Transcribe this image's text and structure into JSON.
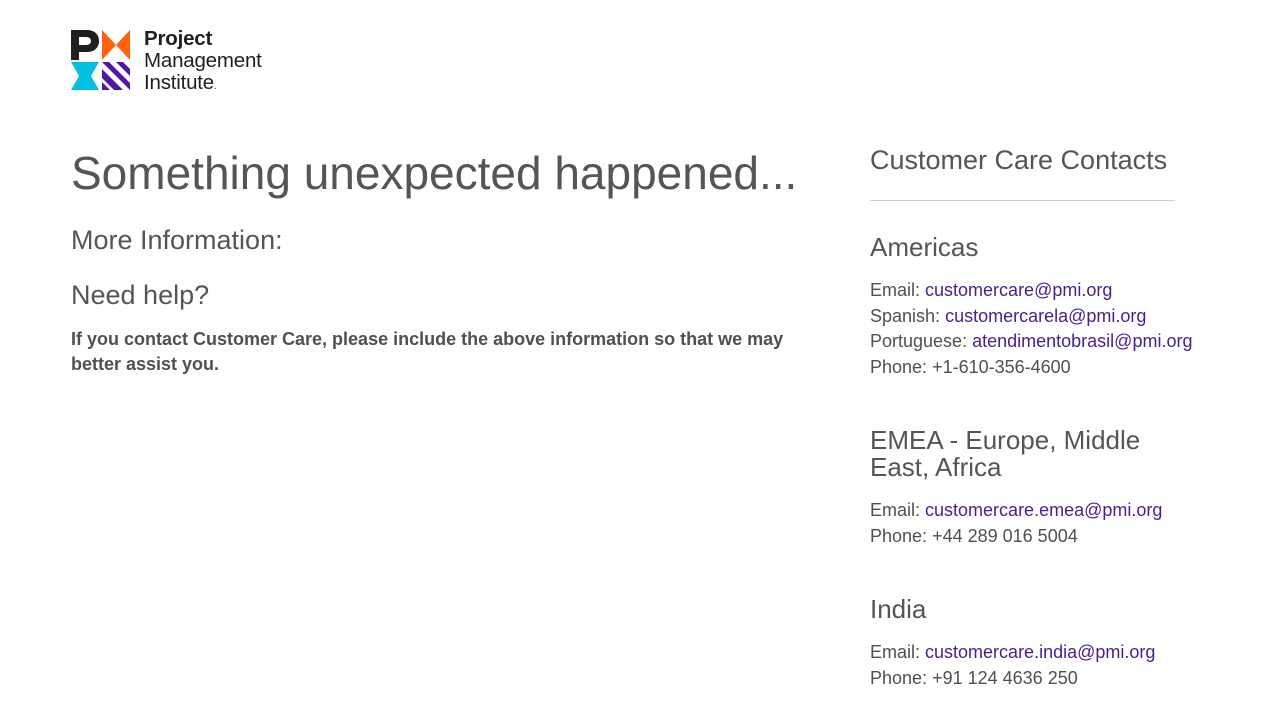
{
  "logo": {
    "line1": "Project",
    "line2": "Management",
    "line3": "Institute",
    "mark_name": "PMI logo mark",
    "colors": {
      "dark": "#1f1f1f",
      "orange": "#ff610f",
      "cyan": "#05bfe0",
      "purple": "#4f17a8"
    }
  },
  "main": {
    "title": "Something unexpected happened...",
    "more_info": "More Information:",
    "need_help": "Need help?",
    "help_text": "If you contact Customer Care, please include the above information so that we may better assist you."
  },
  "contacts": {
    "heading": "Customer Care Contacts",
    "regions": [
      {
        "name": "Americas",
        "lines": [
          {
            "label": "Email:",
            "value": "customercare@pmi.org",
            "is_link": true
          },
          {
            "label": "Spanish:",
            "value": "customercarela@pmi.org",
            "is_link": true
          },
          {
            "label": "Portuguese:",
            "value": "atendimentobrasil@pmi.org",
            "is_link": true
          },
          {
            "label": "Phone:",
            "value": "+1-610-356-4600",
            "is_link": false
          }
        ]
      },
      {
        "name": "EMEA - Europe, Middle East, Africa",
        "lines": [
          {
            "label": "Email:",
            "value": "customercare.emea@pmi.org",
            "is_link": true
          },
          {
            "label": "Phone:",
            "value": "+44 289 016 5004",
            "is_link": false
          }
        ]
      },
      {
        "name": "India",
        "lines": [
          {
            "label": "Email:",
            "value": "customercare.india@pmi.org",
            "is_link": true
          },
          {
            "label": "Phone:",
            "value": "+91 124 4636 250",
            "is_link": false
          }
        ]
      }
    ]
  },
  "colors": {
    "text": "#505050",
    "link": "#4b1e8c",
    "divider": "#cfcfcf"
  }
}
